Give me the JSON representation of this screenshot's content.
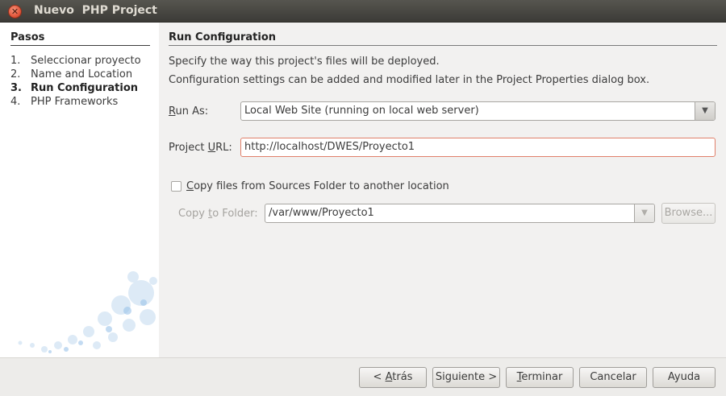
{
  "window": {
    "title": "Nuevo  PHP Project",
    "close_glyph": "✕"
  },
  "sidebar": {
    "title": "Pasos",
    "steps": [
      {
        "num": "1.",
        "label": "Seleccionar proyecto",
        "active": false
      },
      {
        "num": "2.",
        "label": "Name and Location",
        "active": false
      },
      {
        "num": "3.",
        "label": "Run Configuration",
        "active": true
      },
      {
        "num": "4.",
        "label": "PHP Frameworks",
        "active": false
      }
    ]
  },
  "main": {
    "title": "Run Configuration",
    "desc1": "Specify the way this project's files will be deployed.",
    "desc2": "Configuration settings can be added and modified later in the Project Properties dialog box.",
    "run_as": {
      "mnemonic": "R",
      "rest": "un As:",
      "value": "Local Web Site (running on local web server)"
    },
    "project_url": {
      "pre": "Project ",
      "mnemonic": "U",
      "post": "RL:",
      "value": "http://localhost/DWES/Proyecto1"
    },
    "copy_files": {
      "mnemonic": "C",
      "rest": "opy files from Sources Folder to another location",
      "checked": false
    },
    "copy_to": {
      "pre": "Copy ",
      "mnemonic": "t",
      "post": "o Folder:",
      "value": "/var/www/Proyecto1",
      "browse_label": "Browse..."
    }
  },
  "footer": {
    "back": {
      "pre": "< ",
      "mnemonic": "A",
      "post": "trás"
    },
    "next": "Siguiente >",
    "finish": {
      "mnemonic": "T",
      "post": "erminar"
    },
    "cancel": "Cancelar",
    "help": "Ayuda"
  },
  "icons": {
    "dropdown": "dropdown-arrow-icon",
    "close": "close-icon"
  }
}
